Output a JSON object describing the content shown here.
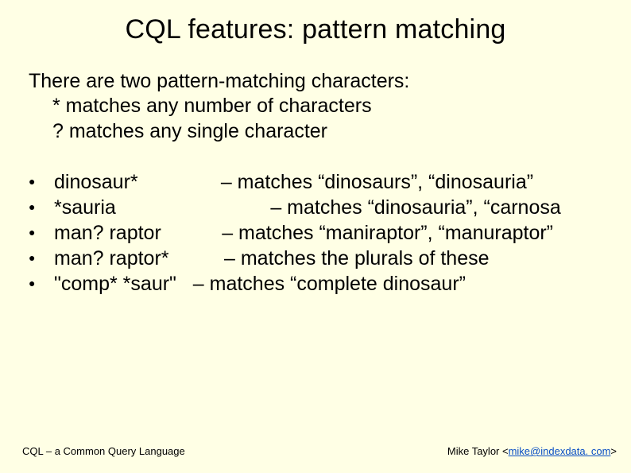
{
  "title": "CQL features: pattern matching",
  "intro": {
    "line1": "There are two pattern-matching characters:",
    "line2": "* matches any number of characters",
    "line3": "? matches any single character"
  },
  "examples": [
    {
      "pattern": "dinosaur*",
      "gap": "               ",
      "match": "– matches “dinosaurs”, “dinosauria”"
    },
    {
      "pattern": "*sauria",
      "gap": "                            ",
      "match": "– matches “dinosauria”, “carnosa"
    },
    {
      "pattern": "man? raptor",
      "gap": "           ",
      "match": "– matches “maniraptor”, “manuraptor”"
    },
    {
      "pattern": "man? raptor*",
      "gap": "          ",
      "match": "– matches the plurals of these"
    },
    {
      "pattern": "\"comp* *saur\"",
      "gap": "   ",
      "match": "– matches “complete dinosaur”"
    }
  ],
  "footer": {
    "left": "CQL – a Common Query Language",
    "right_prefix": "Mike Taylor <",
    "email": "mike@indexdata. com",
    "right_suffix": ">"
  },
  "glyphs": {
    "bullet": "●"
  }
}
